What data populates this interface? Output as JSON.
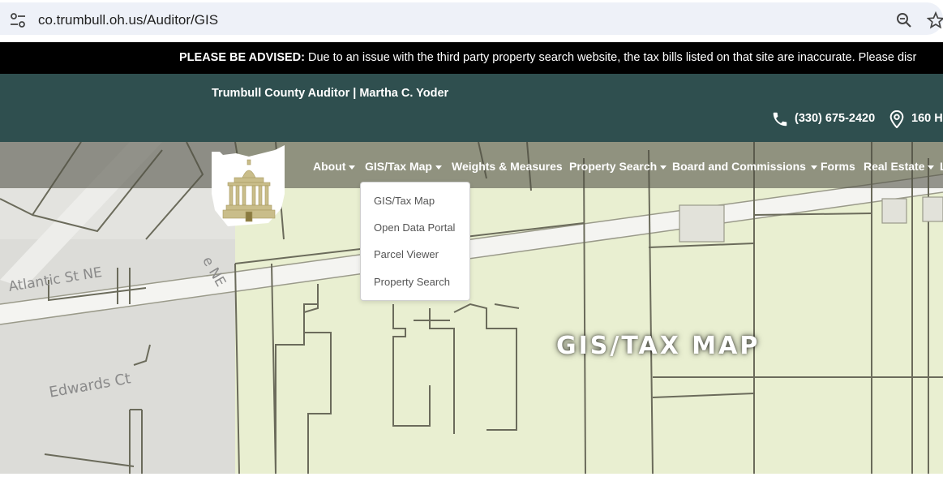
{
  "browser": {
    "url": "co.trumbull.oh.us/Auditor/GIS",
    "icons": [
      "tune-icon",
      "zoom-icon",
      "star-icon"
    ]
  },
  "advisory": {
    "label": "PLEASE BE ADVISED:",
    "message": " Due to an issue with the third party property search website, the tax bills listed on that site are inaccurate. Please disr"
  },
  "topbar": {
    "site_name": "Trumbull County Auditor | Martha C. Yoder",
    "phone": "(330) 675-2420",
    "address": "160 H"
  },
  "nav": {
    "items": [
      {
        "label": "About",
        "caret": true
      },
      {
        "label": "GIS/Tax Map",
        "caret": true
      },
      {
        "label": "Weights & Measures",
        "caret": false
      },
      {
        "label": "Property Search",
        "caret": true
      },
      {
        "label": "Board and Commissions",
        "caret": true
      },
      {
        "label": "Forms",
        "caret": false
      },
      {
        "label": "Real Estate",
        "caret": true
      },
      {
        "label": "L",
        "caret": false
      }
    ]
  },
  "dropdown": {
    "items": [
      "GIS/Tax Map",
      "Open Data Portal",
      "Parcel Viewer",
      "Property Search"
    ]
  },
  "hero": {
    "title": "GIS/TAX MAP"
  },
  "map_labels": {
    "street1": "Atlantic St NE",
    "street2": "e NE",
    "street3": "Edwards Ct"
  },
  "colors": {
    "topbar": "#2f4f4f",
    "advisory": "#000000",
    "map_bg": "#e9efd1",
    "parcel_line": "#6b6b5b"
  }
}
